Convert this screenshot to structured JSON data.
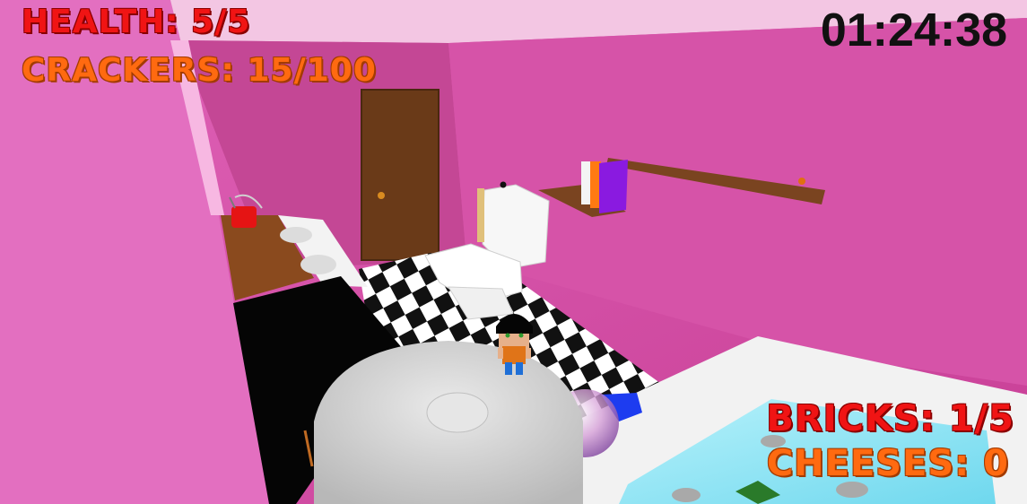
{
  "hud": {
    "health": "HEALTH: 5/5",
    "crackers": "CRACKERS: 15/100",
    "timer": "01:24:38",
    "bricks": "BRICKS: 1/5",
    "cheeses": "CHEESES: 0"
  },
  "colors": {
    "wall": "#d94fa8",
    "floor_dark": "#111111",
    "floor_light": "#ffffff",
    "health_text": "#f01414",
    "collectible_text": "#ff6a10",
    "timer_text": "#111111",
    "door": "#6a3a18",
    "water": "#9fe8f8"
  },
  "scene_objects": [
    "bathroom-wall",
    "door",
    "toilet",
    "shelf",
    "books",
    "sink-counter",
    "red-cup",
    "checkered-floor",
    "toilet-paper-roll",
    "player-character",
    "bathtub",
    "glass-marble"
  ]
}
